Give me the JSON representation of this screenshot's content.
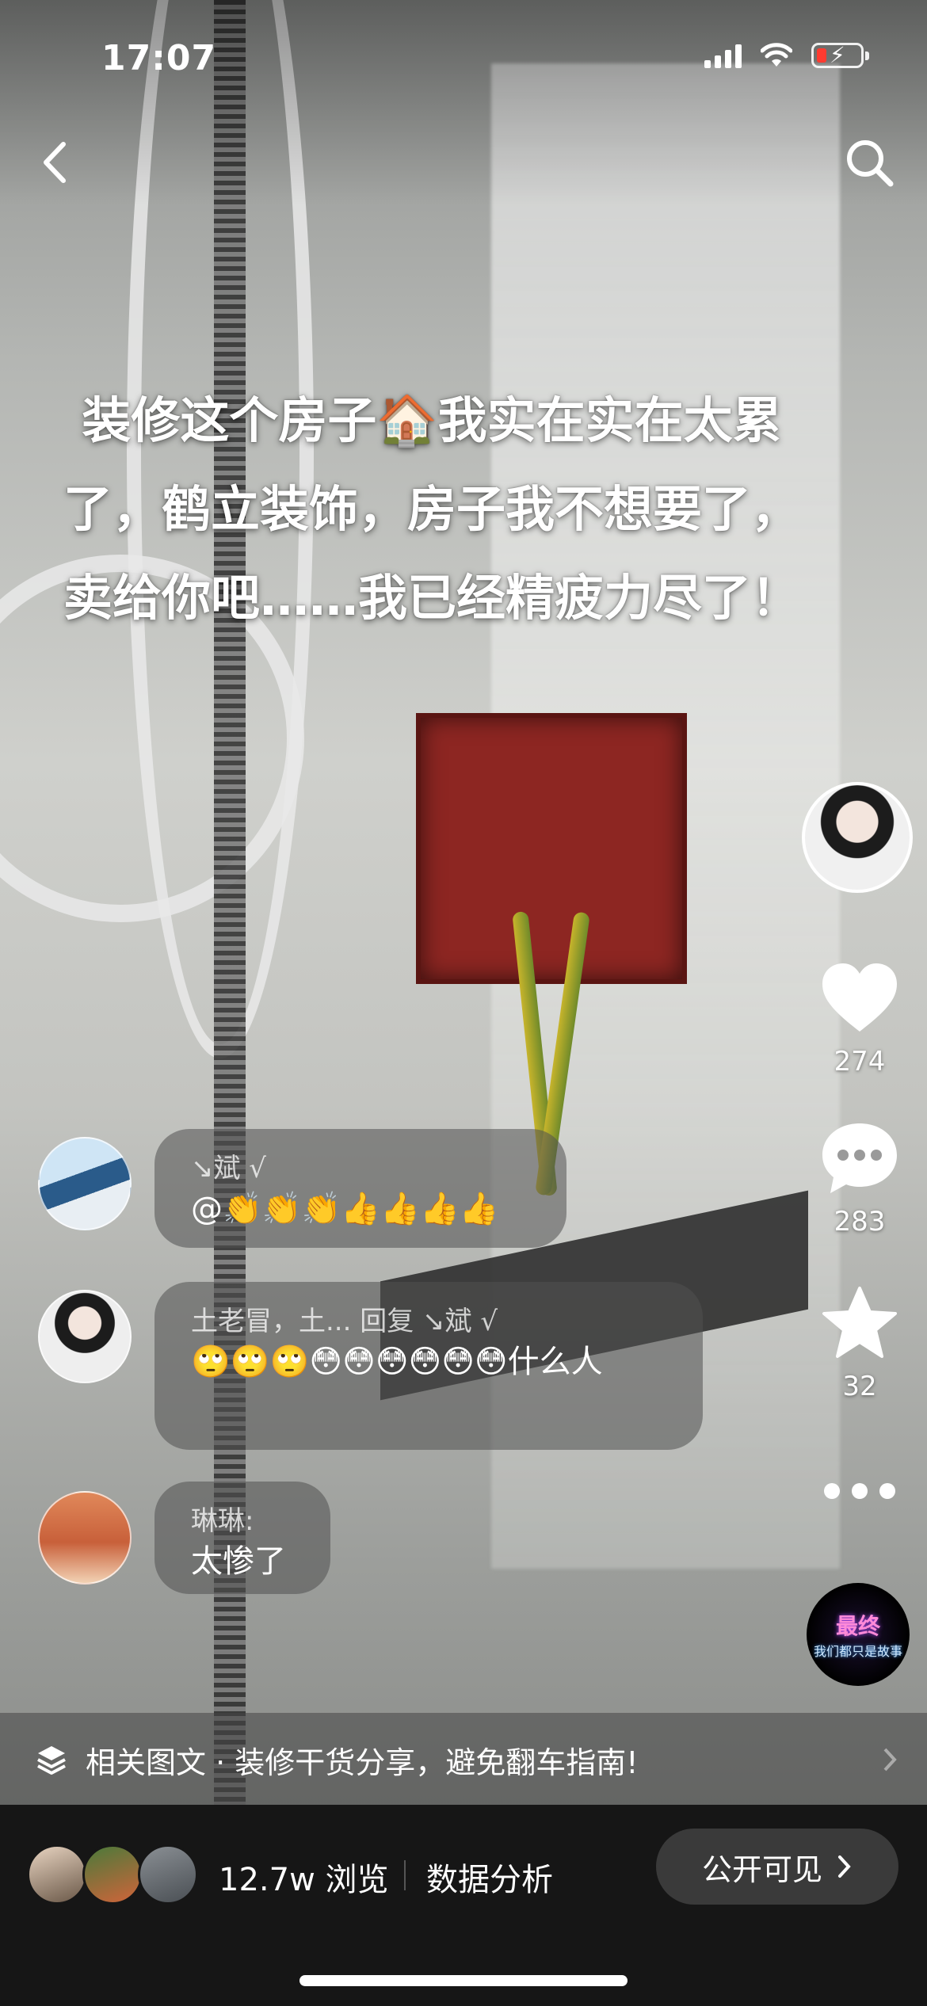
{
  "status_bar": {
    "time": "17:07",
    "battery_state": "low-charging"
  },
  "nav": {
    "back_icon": "chevron-left-icon",
    "search_icon": "search-icon"
  },
  "caption": {
    "text": "装修这个房子🏠我实在实在太累了，鹤立装饰，房子我不想要了，卖给你吧……我已经精疲力尽了！"
  },
  "actions": {
    "likes": "274",
    "comments": "283",
    "favorites": "32",
    "more_icon": "more-dots-icon"
  },
  "music": {
    "line1": "最终",
    "line2": "我们都只是故事"
  },
  "comments": [
    {
      "author": "↘斌 √",
      "text": "@👏👏👏👍👍👍👍"
    },
    {
      "author": "土老冒，土... 回复 ↘斌 √",
      "text": "🙄🙄🙄😳😳😳😳😳😳什么人"
    },
    {
      "author": "琳琳:",
      "text": "太惨了"
    }
  ],
  "related": {
    "text": "相关图文 · 装修干货分享，避免翻车指南!"
  },
  "bottom_bar": {
    "views": "12.7w 浏览",
    "analysis": "数据分析",
    "visibility": "公开可见"
  },
  "colors": {
    "like_red": "#ff3b30",
    "bottom_bg": "#161616"
  }
}
